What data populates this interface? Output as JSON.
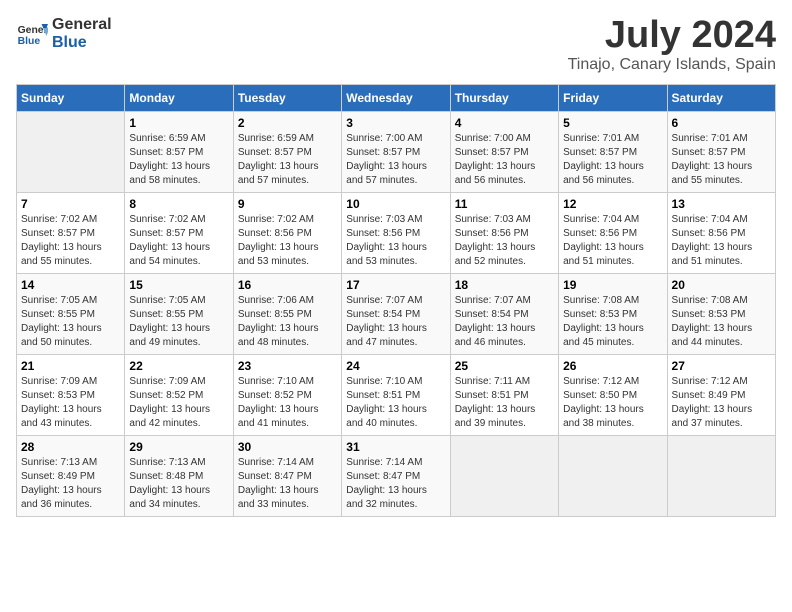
{
  "logo": {
    "general": "General",
    "blue": "Blue"
  },
  "title": {
    "month_year": "July 2024",
    "location": "Tinajo, Canary Islands, Spain"
  },
  "weekdays": [
    "Sunday",
    "Monday",
    "Tuesday",
    "Wednesday",
    "Thursday",
    "Friday",
    "Saturday"
  ],
  "weeks": [
    [
      {
        "day": "",
        "info": ""
      },
      {
        "day": "1",
        "info": "Sunrise: 6:59 AM\nSunset: 8:57 PM\nDaylight: 13 hours\nand 58 minutes."
      },
      {
        "day": "2",
        "info": "Sunrise: 6:59 AM\nSunset: 8:57 PM\nDaylight: 13 hours\nand 57 minutes."
      },
      {
        "day": "3",
        "info": "Sunrise: 7:00 AM\nSunset: 8:57 PM\nDaylight: 13 hours\nand 57 minutes."
      },
      {
        "day": "4",
        "info": "Sunrise: 7:00 AM\nSunset: 8:57 PM\nDaylight: 13 hours\nand 56 minutes."
      },
      {
        "day": "5",
        "info": "Sunrise: 7:01 AM\nSunset: 8:57 PM\nDaylight: 13 hours\nand 56 minutes."
      },
      {
        "day": "6",
        "info": "Sunrise: 7:01 AM\nSunset: 8:57 PM\nDaylight: 13 hours\nand 55 minutes."
      }
    ],
    [
      {
        "day": "7",
        "info": "Sunrise: 7:02 AM\nSunset: 8:57 PM\nDaylight: 13 hours\nand 55 minutes."
      },
      {
        "day": "8",
        "info": "Sunrise: 7:02 AM\nSunset: 8:57 PM\nDaylight: 13 hours\nand 54 minutes."
      },
      {
        "day": "9",
        "info": "Sunrise: 7:02 AM\nSunset: 8:56 PM\nDaylight: 13 hours\nand 53 minutes."
      },
      {
        "day": "10",
        "info": "Sunrise: 7:03 AM\nSunset: 8:56 PM\nDaylight: 13 hours\nand 53 minutes."
      },
      {
        "day": "11",
        "info": "Sunrise: 7:03 AM\nSunset: 8:56 PM\nDaylight: 13 hours\nand 52 minutes."
      },
      {
        "day": "12",
        "info": "Sunrise: 7:04 AM\nSunset: 8:56 PM\nDaylight: 13 hours\nand 51 minutes."
      },
      {
        "day": "13",
        "info": "Sunrise: 7:04 AM\nSunset: 8:56 PM\nDaylight: 13 hours\nand 51 minutes."
      }
    ],
    [
      {
        "day": "14",
        "info": "Sunrise: 7:05 AM\nSunset: 8:55 PM\nDaylight: 13 hours\nand 50 minutes."
      },
      {
        "day": "15",
        "info": "Sunrise: 7:05 AM\nSunset: 8:55 PM\nDaylight: 13 hours\nand 49 minutes."
      },
      {
        "day": "16",
        "info": "Sunrise: 7:06 AM\nSunset: 8:55 PM\nDaylight: 13 hours\nand 48 minutes."
      },
      {
        "day": "17",
        "info": "Sunrise: 7:07 AM\nSunset: 8:54 PM\nDaylight: 13 hours\nand 47 minutes."
      },
      {
        "day": "18",
        "info": "Sunrise: 7:07 AM\nSunset: 8:54 PM\nDaylight: 13 hours\nand 46 minutes."
      },
      {
        "day": "19",
        "info": "Sunrise: 7:08 AM\nSunset: 8:53 PM\nDaylight: 13 hours\nand 45 minutes."
      },
      {
        "day": "20",
        "info": "Sunrise: 7:08 AM\nSunset: 8:53 PM\nDaylight: 13 hours\nand 44 minutes."
      }
    ],
    [
      {
        "day": "21",
        "info": "Sunrise: 7:09 AM\nSunset: 8:53 PM\nDaylight: 13 hours\nand 43 minutes."
      },
      {
        "day": "22",
        "info": "Sunrise: 7:09 AM\nSunset: 8:52 PM\nDaylight: 13 hours\nand 42 minutes."
      },
      {
        "day": "23",
        "info": "Sunrise: 7:10 AM\nSunset: 8:52 PM\nDaylight: 13 hours\nand 41 minutes."
      },
      {
        "day": "24",
        "info": "Sunrise: 7:10 AM\nSunset: 8:51 PM\nDaylight: 13 hours\nand 40 minutes."
      },
      {
        "day": "25",
        "info": "Sunrise: 7:11 AM\nSunset: 8:51 PM\nDaylight: 13 hours\nand 39 minutes."
      },
      {
        "day": "26",
        "info": "Sunrise: 7:12 AM\nSunset: 8:50 PM\nDaylight: 13 hours\nand 38 minutes."
      },
      {
        "day": "27",
        "info": "Sunrise: 7:12 AM\nSunset: 8:49 PM\nDaylight: 13 hours\nand 37 minutes."
      }
    ],
    [
      {
        "day": "28",
        "info": "Sunrise: 7:13 AM\nSunset: 8:49 PM\nDaylight: 13 hours\nand 36 minutes."
      },
      {
        "day": "29",
        "info": "Sunrise: 7:13 AM\nSunset: 8:48 PM\nDaylight: 13 hours\nand 34 minutes."
      },
      {
        "day": "30",
        "info": "Sunrise: 7:14 AM\nSunset: 8:47 PM\nDaylight: 13 hours\nand 33 minutes."
      },
      {
        "day": "31",
        "info": "Sunrise: 7:14 AM\nSunset: 8:47 PM\nDaylight: 13 hours\nand 32 minutes."
      },
      {
        "day": "",
        "info": ""
      },
      {
        "day": "",
        "info": ""
      },
      {
        "day": "",
        "info": ""
      }
    ]
  ]
}
